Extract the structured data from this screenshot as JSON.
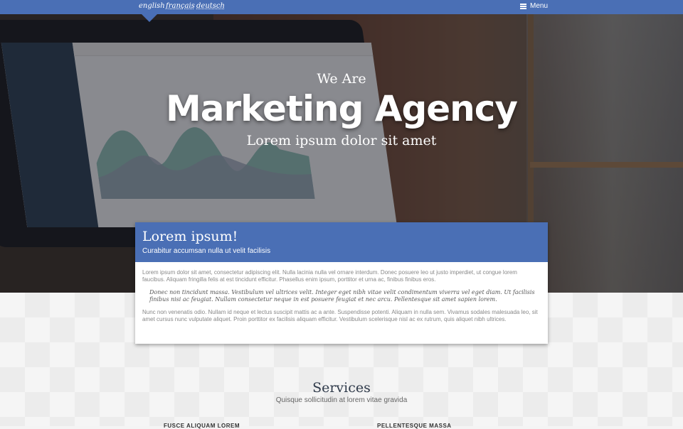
{
  "nav": {
    "languages": [
      {
        "label": "english",
        "active": true
      },
      {
        "label": "français",
        "active": false
      },
      {
        "label": "deutsch",
        "active": false
      }
    ],
    "menu_label": "Menu",
    "bar_color": "#4a6fb5"
  },
  "hero": {
    "pre_title": "We Are",
    "title": "Marketing Agency",
    "subtitle": "Lorem ipsum dolor sit amet"
  },
  "card": {
    "title": "Lorem ipsum!",
    "subtitle": "Curabitur accumsan nulla ut velit facilisis",
    "paragraph1": "Lorem ipsum dolor sit amet, consectetur adipiscing elit. Nulla lacinia nulla vel ornare interdum. Donec posuere leo ut justo imperdiet, ut congue lorem faucibus. Aliquam fringilla felis at est tincidunt efficitur. Phasellus enim ipsum, porttitor et urna ac, finibus finibus eros.",
    "quote": "Donec non tincidunt massa. Vestibulum vel ultrices velit. Integer eget nibh vitae velit condimentum viverra vel eget diam. Ut facilisis finibus nisi ac feugiat. Nullam consectetur neque in est posuere feugiat et nec arcu. Pellentesque sit amet sapien lorem.",
    "paragraph2": "Nunc non venenatis odio. Nullam id neque et lectus suscipit mattis ac a ante. Suspendisse potenti. Aliquam in nulla sem. Vivamus sodales malesuada leo, sit amet cursus nunc vulputate aliquet. Proin porttitor ex facilisis aliquam efficitur. Vestibulum scelerisque nisl ac ex rutrum, quis aliquet nibh ultrices."
  },
  "services": {
    "title": "Services",
    "subtitle": "Quisque sollicitudin at lorem vitae gravida",
    "columns": [
      "FUSCE ALIQUAM LOREM",
      "PELLENTESQUE MASSA"
    ]
  }
}
